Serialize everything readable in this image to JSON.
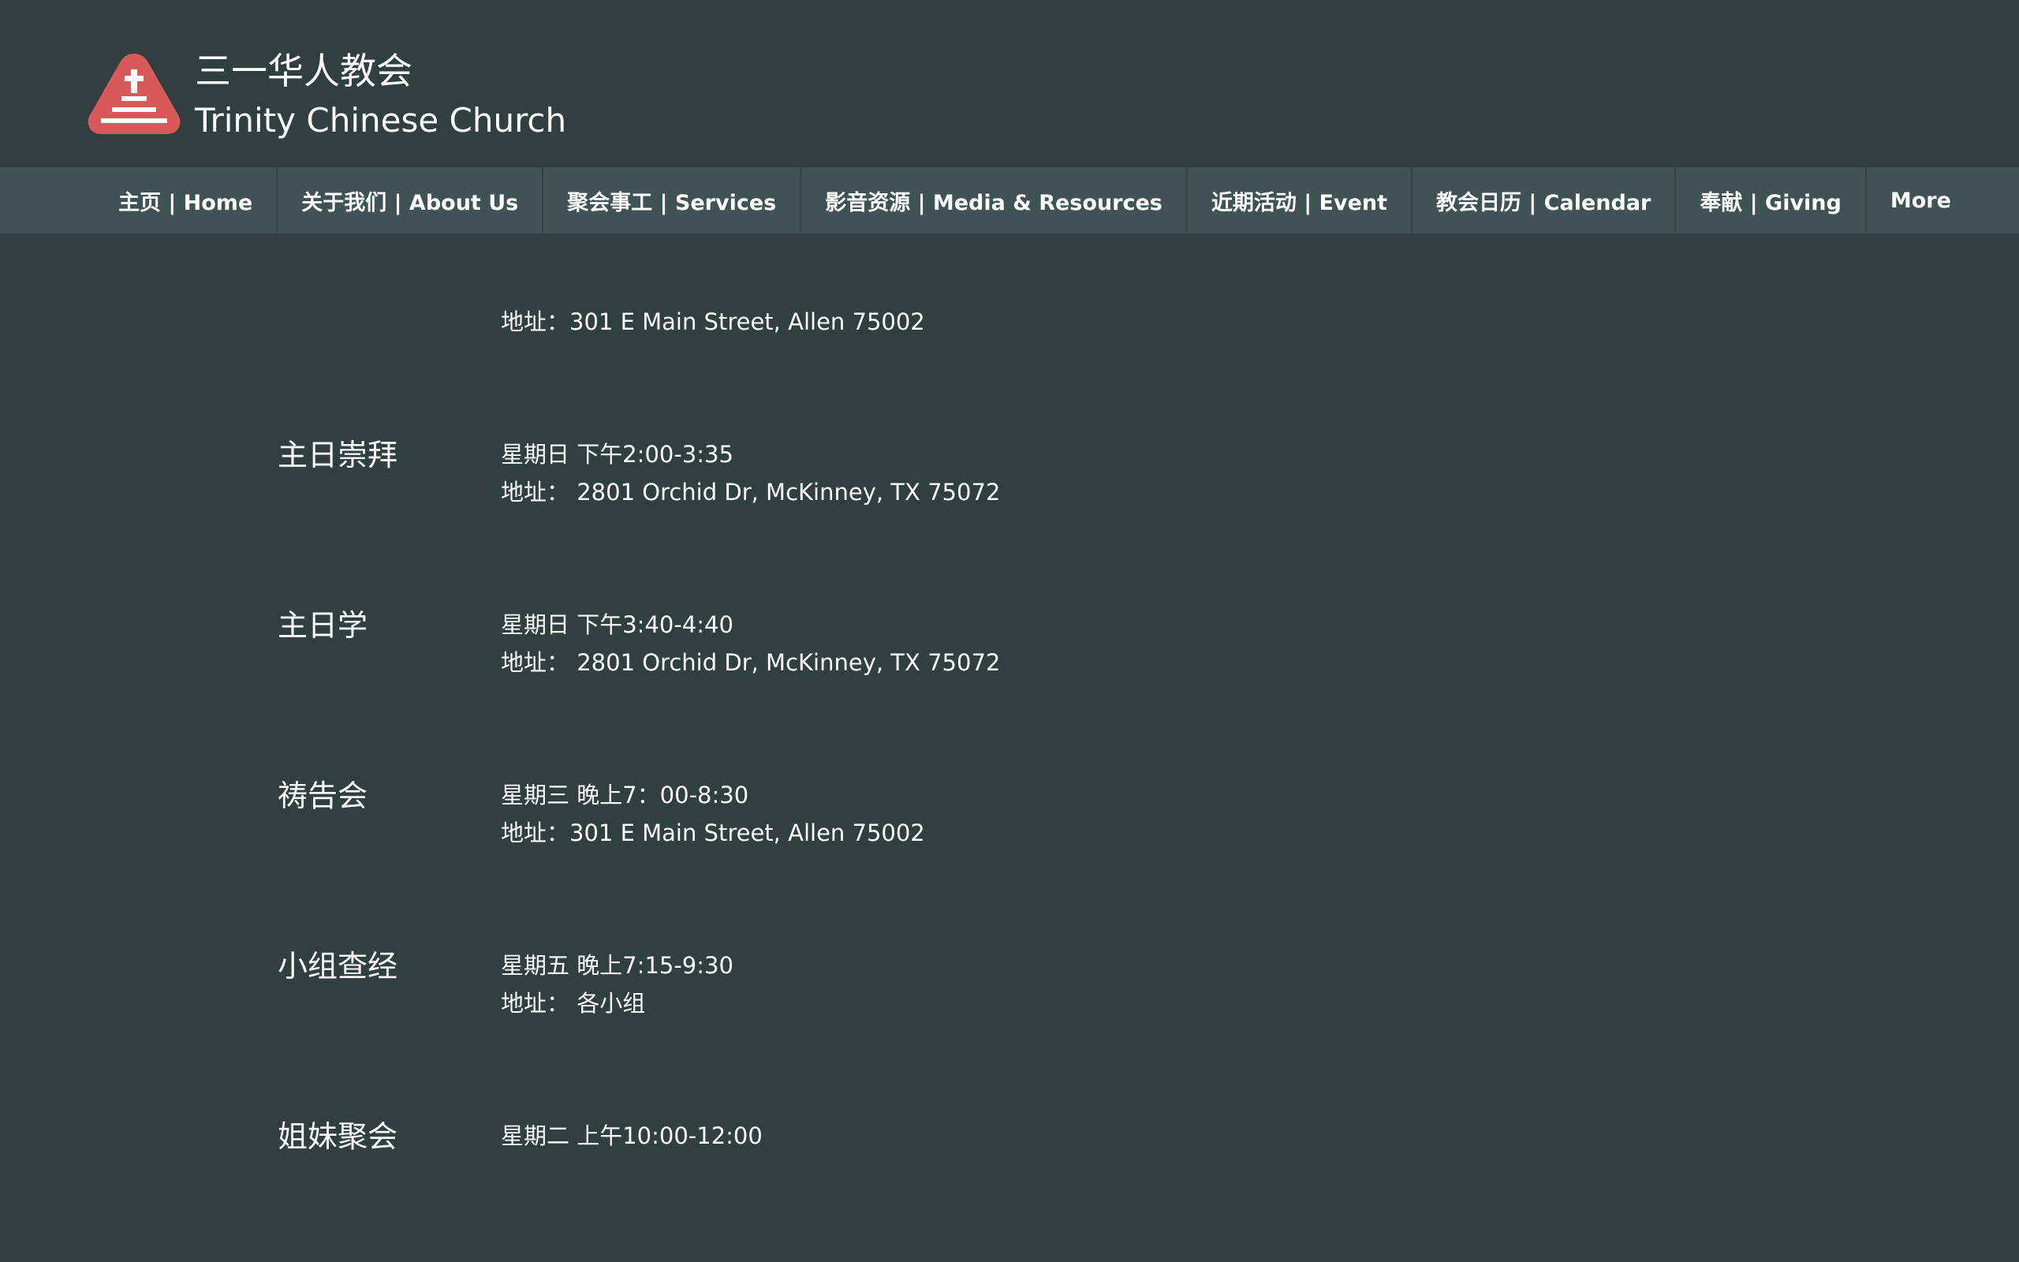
{
  "header": {
    "title_cn": "三一华人教会",
    "title_en": "Trinity Chinese Church",
    "logo_icon": "church-cross-icon",
    "logo_color": "#d9585a"
  },
  "nav": {
    "items": [
      {
        "label": "主页 | Home"
      },
      {
        "label": "关于我们 | About Us"
      },
      {
        "label": "聚会事工 | Services"
      },
      {
        "label": "影音资源 | Media & Resources"
      },
      {
        "label": "近期活动 | Event"
      },
      {
        "label": "教会日历 | Calendar"
      },
      {
        "label": "奉献 | Giving"
      },
      {
        "label": "More"
      }
    ]
  },
  "schedule": {
    "top_address": "地址：301 E Main Street, Allen 75002",
    "items": [
      {
        "name": "主日崇拜",
        "time": "星期日 下午2:00-3:35",
        "address": "地址：  2801 Orchid Dr, McKinney, TX 75072"
      },
      {
        "name": "主日学",
        "time": "星期日 下午3:40-4:40",
        "address": "地址：  2801 Orchid Dr, McKinney, TX 75072"
      },
      {
        "name": "祷告会",
        "time": "星期三 晚上7：00-8:30",
        "address": "地址：301 E Main Street, Allen 75002"
      },
      {
        "name": "小组查经",
        "time": "星期五 晚上7:15-9:30",
        "address": "地址：  各小组"
      },
      {
        "name": "姐妹聚会",
        "time": "星期二 上午10:00-12:00"
      }
    ]
  },
  "colors": {
    "background": "#313f40",
    "nav_background": "#405354",
    "text": "#ffffff"
  }
}
